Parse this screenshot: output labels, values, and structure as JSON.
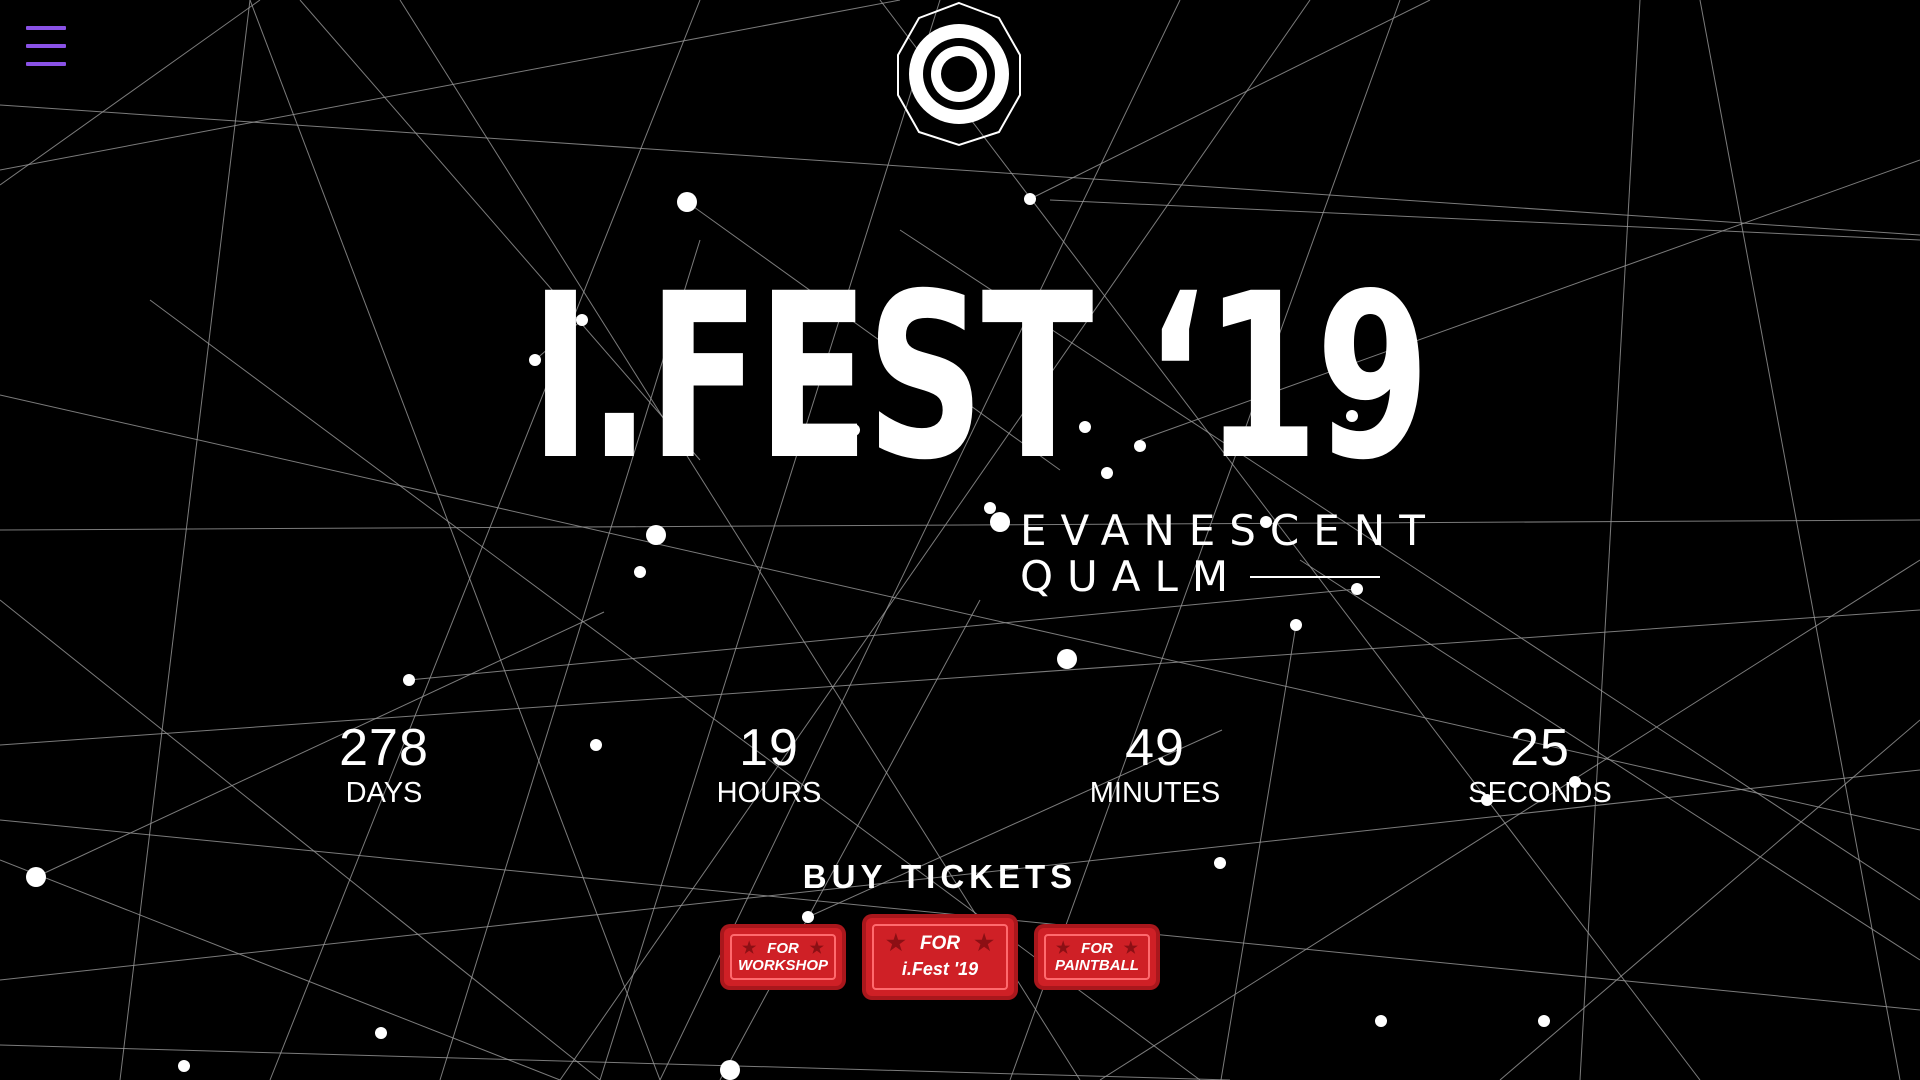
{
  "menu": {
    "icon": "hamburger-menu-icon",
    "accent": "#8a52e6"
  },
  "logo": {
    "icon": "circle-logo-icon"
  },
  "hero": {
    "title": "I.FEST ‘19",
    "tagline_line1": "EVANESCENT",
    "tagline_line2": "QUALM"
  },
  "countdown": {
    "days": {
      "value": "278",
      "label": "DAYS"
    },
    "hours": {
      "value": "19",
      "label": "HOURS"
    },
    "minutes": {
      "value": "49",
      "label": "MINUTES"
    },
    "seconds": {
      "value": "25",
      "label": "SECONDS"
    }
  },
  "tickets": {
    "heading": "BUY TICKETS",
    "workshop": {
      "line1": "FOR",
      "line2": "WORKSHOP"
    },
    "fest": {
      "line1": "FOR",
      "line2": "i.Fest '19"
    },
    "paintball": {
      "line1": "FOR",
      "line2": "PAINTBALL"
    },
    "color": "#cf2026"
  }
}
